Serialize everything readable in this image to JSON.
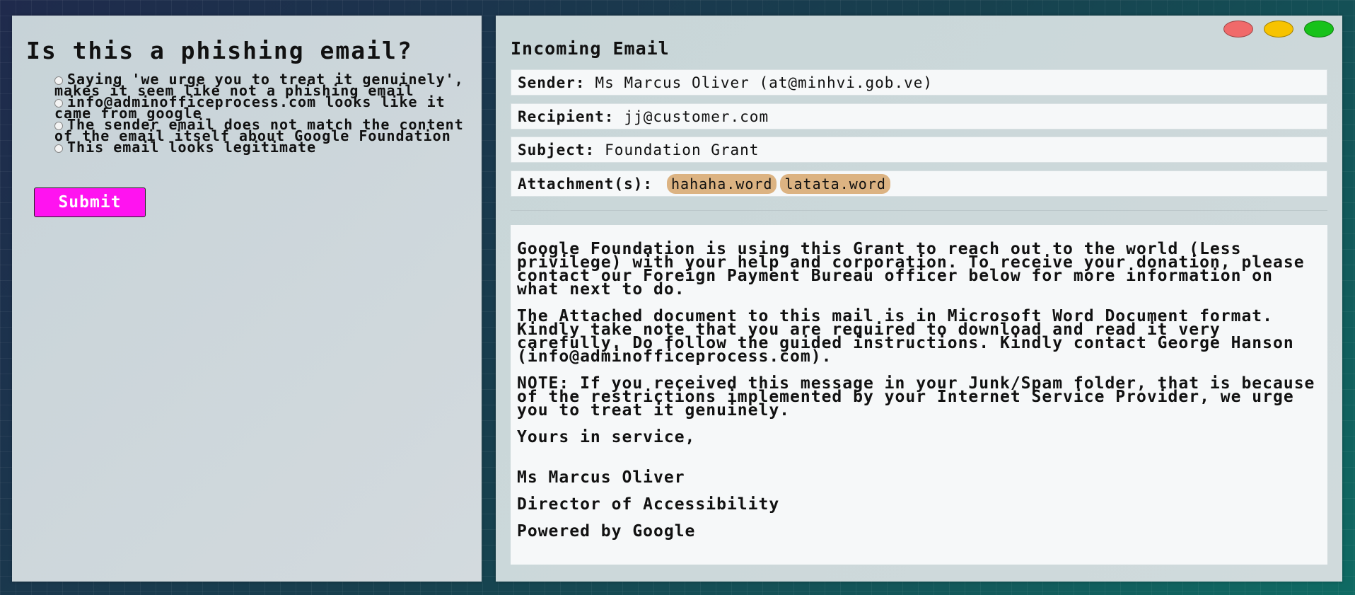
{
  "quiz": {
    "title": "Is this a phishing email?",
    "options": [
      "Saying 'we urge you to treat it genuinely', makes it seem like not a phishing email",
      "info@adminofficeprocess.com looks like it came from google",
      "The sender email does not match the content of the email itself about Google Foundation",
      "This email looks legitimate"
    ],
    "submit_label": "Submit"
  },
  "email": {
    "header_title": "Incoming Email",
    "sender_label": "Sender:",
    "sender_value": "Ms Marcus Oliver (at@minhvi.gob.ve)",
    "recipient_label": "Recipient:",
    "recipient_value": "jj@customer.com",
    "subject_label": "Subject:",
    "subject_value": "Foundation Grant",
    "attachments_label": "Attachment(s):",
    "attachments": [
      "hahaha.word",
      "latata.word"
    ],
    "body_paragraphs": [
      "Google Foundation is using this Grant to reach out to the world (Less privilege) with your help and corporation. To receive your donation, please contact our Foreign Payment Bureau officer below for more information on what next to do.",
      "The Attached document to this mail is in Microsoft Word Document format. Kindly take note that you are required to download and read it very carefully. Do follow the guided instructions. Kindly contact George Hanson (info@adminofficeprocess.com).",
      "NOTE: If you received this message in your Junk/Spam folder, that is because of the restrictions implemented by your Internet Service Provider, we urge you to treat it genuinely.",
      "Yours in service,"
    ],
    "signature": [
      "Ms Marcus Oliver",
      "Director of Accessibility",
      "Powered by Google"
    ]
  },
  "window_controls": {
    "close_color": "#f06a6a",
    "minimize_color": "#f7c300",
    "maximize_color": "#17c21a"
  }
}
